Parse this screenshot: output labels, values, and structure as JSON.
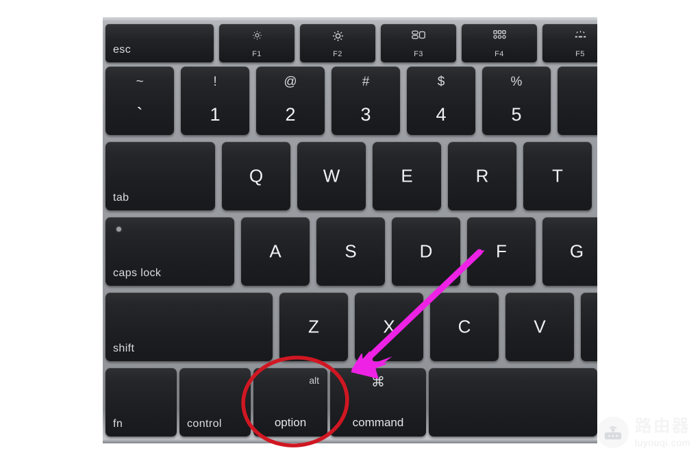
{
  "scene": {
    "subject": "macbook-keyboard-photo",
    "background_color": "#ffffff",
    "chassis_color": "#9a9da2",
    "key_color": "#212326"
  },
  "keyboard": {
    "function_row": [
      {
        "id": "esc",
        "label": "esc",
        "icon": "",
        "caption": ""
      },
      {
        "id": "f1",
        "label": "",
        "icon": "brightness-low-icon",
        "caption": "F1"
      },
      {
        "id": "f2",
        "label": "",
        "icon": "brightness-high-icon",
        "caption": "F2"
      },
      {
        "id": "f3",
        "label": "",
        "icon": "mission-control-icon",
        "caption": "F3"
      },
      {
        "id": "f4",
        "label": "",
        "icon": "launchpad-icon",
        "caption": "F4"
      },
      {
        "id": "f5",
        "label": "",
        "icon": "keyboard-backlight-icon",
        "caption": "F5"
      }
    ],
    "number_row": [
      {
        "id": "grave",
        "upper": "~",
        "lower": "`"
      },
      {
        "id": "one",
        "upper": "!",
        "lower": "1"
      },
      {
        "id": "two",
        "upper": "@",
        "lower": "2"
      },
      {
        "id": "three",
        "upper": "#",
        "lower": "3"
      },
      {
        "id": "four",
        "upper": "$",
        "lower": "4"
      },
      {
        "id": "five",
        "upper": "%",
        "lower": "5"
      }
    ],
    "tab_row": {
      "modifier": "tab",
      "letters": [
        "Q",
        "W",
        "E",
        "R",
        "T"
      ]
    },
    "caps_row": {
      "modifier": "caps lock",
      "letters": [
        "A",
        "S",
        "D",
        "F",
        "G"
      ]
    },
    "shift_row": {
      "modifier": "shift",
      "letters": [
        "Z",
        "X",
        "C",
        "V"
      ]
    },
    "bottom_row": {
      "fn": "fn",
      "control": "control",
      "option_top": "alt",
      "option_bottom": "option",
      "command_top": "⌘",
      "command_bottom": "command",
      "space": ""
    }
  },
  "annotations": {
    "highlight_circle": {
      "target": "option",
      "color": "#d01722",
      "shape": "ellipse"
    },
    "arrow": {
      "color": "#ec22e0",
      "points_to": "option",
      "origin": "f-key-area"
    }
  },
  "watermark": {
    "title": "路由器",
    "url": "luyouqi.com",
    "icon": "router-icon"
  }
}
